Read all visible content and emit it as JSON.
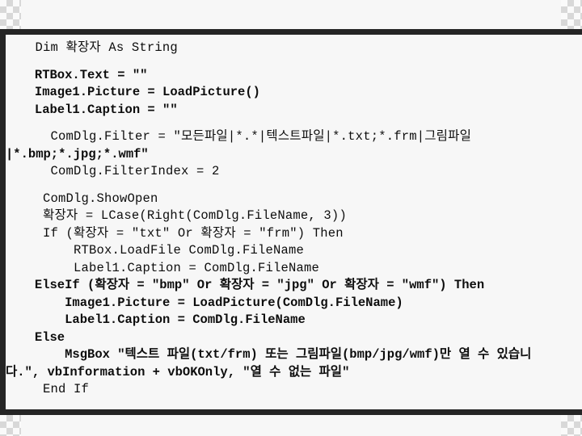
{
  "slide": {
    "kind": "code-listing",
    "language": "Visual Basic",
    "frame_color": "#252525",
    "background_color": "#f7f7f7",
    "text_color": "#0d0d0d"
  },
  "code": {
    "lines": [
      {
        "id": "l1",
        "text": "   Dim 확장자 As String",
        "bold": false,
        "space_before": "none"
      },
      {
        "id": "l2",
        "text": "   RTBox.Text = \"\"",
        "bold": true,
        "space_before": "sm"
      },
      {
        "id": "l3",
        "text": "   Image1.Picture = LoadPicture()",
        "bold": true,
        "space_before": "none"
      },
      {
        "id": "l4",
        "text": "   Label1.Caption = \"\"",
        "bold": true,
        "space_before": "none"
      },
      {
        "id": "l5",
        "text": "     ComDlg.Filter = \"모든파일|*.*|텍스트파일|*.txt;*.frm|그림파일",
        "bold": false,
        "space_before": "sm"
      },
      {
        "id": "l6",
        "text": "|*.bmp;*.jpg;*.wmf\"",
        "bold": true,
        "space_before": "none"
      },
      {
        "id": "l7",
        "text": "     ComDlg.FilterIndex = 2",
        "bold": false,
        "space_before": "none"
      },
      {
        "id": "l8",
        "text": "    ComDlg.ShowOpen",
        "bold": false,
        "space_before": "sm"
      },
      {
        "id": "l9",
        "text": "    확장자 = LCase(Right(ComDlg.FileName, 3))",
        "bold": false,
        "space_before": "none"
      },
      {
        "id": "l10",
        "text": "    If (확장자 = \"txt\" Or 확장자 = \"frm\") Then",
        "bold": false,
        "space_before": "none"
      },
      {
        "id": "l11",
        "text": "        RTBox.LoadFile ComDlg.FileName",
        "bold": false,
        "space_before": "none"
      },
      {
        "id": "l12",
        "text": "        Label1.Caption = ComDlg.FileName",
        "bold": false,
        "space_before": "none"
      },
      {
        "id": "l13",
        "text": "   ElseIf (확장자 = \"bmp\" Or 확장자 = \"jpg\" Or 확장자 = \"wmf\") Then",
        "bold": true,
        "space_before": "none"
      },
      {
        "id": "l14",
        "text": "       Image1.Picture = LoadPicture(ComDlg.FileName)",
        "bold": true,
        "space_before": "none"
      },
      {
        "id": "l15",
        "text": "       Label1.Caption = ComDlg.FileName",
        "bold": true,
        "space_before": "none"
      },
      {
        "id": "l16",
        "text": "   Else",
        "bold": true,
        "space_before": "none"
      },
      {
        "id": "l17",
        "text": "       MsgBox \"텍스트 파일(txt/frm) 또는 그림파일(bmp/jpg/wmf)만 열 수 있습니",
        "bold": true,
        "space_before": "none"
      },
      {
        "id": "l18",
        "text": "다.\", vbInformation + vbOKOnly, \"열 수 없는 파일\"",
        "bold": true,
        "space_before": "none"
      },
      {
        "id": "l19",
        "text": "    End If",
        "bold": false,
        "space_before": "none"
      }
    ]
  },
  "decorations": {
    "checker_top_left": "checkerboard-pattern",
    "checker_top_right": "checkerboard-pattern",
    "checker_bottom_left": "checkerboard-pattern",
    "checker_bottom_right": "checkerboard-pattern"
  }
}
